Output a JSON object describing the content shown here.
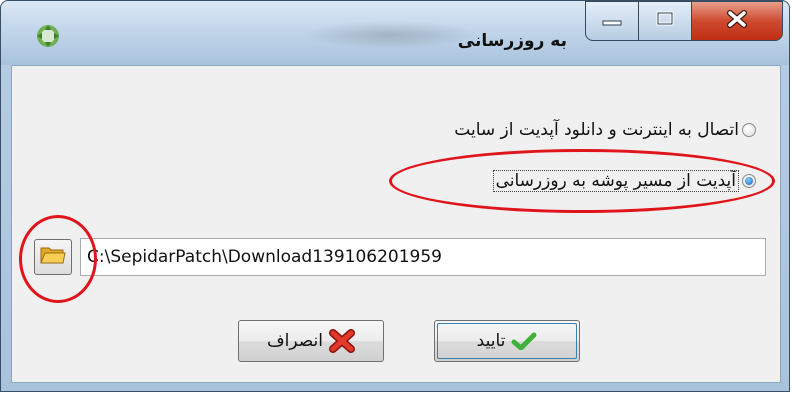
{
  "window": {
    "title": "به روزرسانی"
  },
  "options": {
    "internet": {
      "label": "اتصال به اینترنت و دانلود آپدیت از سایت",
      "checked": false
    },
    "folder": {
      "label": "آپدیت از مسیر پوشه به روزرسانی",
      "checked": true
    }
  },
  "path": {
    "value": "C:\\SepidarPatch\\Download139106201959"
  },
  "buttons": {
    "ok_label": "تایید",
    "cancel_label": "انصراف"
  },
  "colors": {
    "highlight": "#e0141b",
    "close": "#c7381c",
    "ok_check": "#3fb23b",
    "cancel_x": "#d42020"
  },
  "icons": [
    "app-icon",
    "minimize-icon",
    "maximize-icon",
    "close-icon",
    "folder-icon",
    "check-icon",
    "x-icon"
  ]
}
